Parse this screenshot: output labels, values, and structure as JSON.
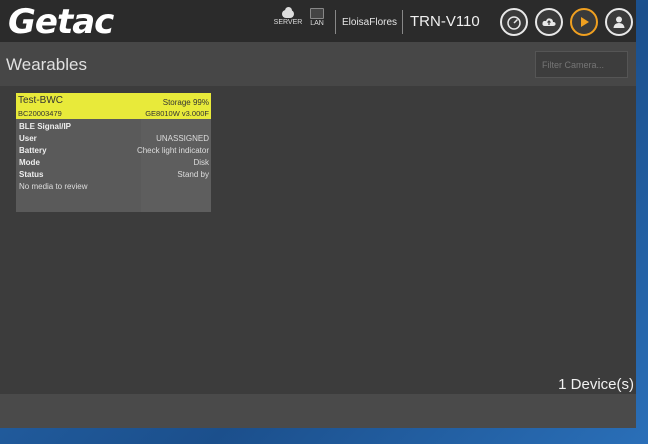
{
  "app": {
    "brand": "Getac"
  },
  "topbar": {
    "server_label": "SERVER",
    "lan_label": "LAN",
    "username": "EloisaFlores",
    "device_id": "TRN-V110",
    "icons": [
      "gauge-icon",
      "cloud-sync-icon",
      "play-icon",
      "user-icon"
    ],
    "accent_color": "#f0a020"
  },
  "page": {
    "title": "Wearables",
    "filter_placeholder": "Filter Camera..."
  },
  "cards": [
    {
      "name": "Test-BWC",
      "storage": "Storage 99%",
      "serial": "BC20003479",
      "firmware": "GE8010W v3.000F",
      "header_color": "#e8ea3a",
      "ble_label": "BLE Signal/IP",
      "user_label": "User",
      "user_value": "UNASSIGNED",
      "battery_label": "Battery",
      "battery_value": "Check light indicator",
      "mode_label": "Mode",
      "mode_value": "Disk",
      "status_label": "Status",
      "status_value": "Stand by",
      "media_note": "No media to review"
    }
  ],
  "device_count": "1 Device(s)"
}
